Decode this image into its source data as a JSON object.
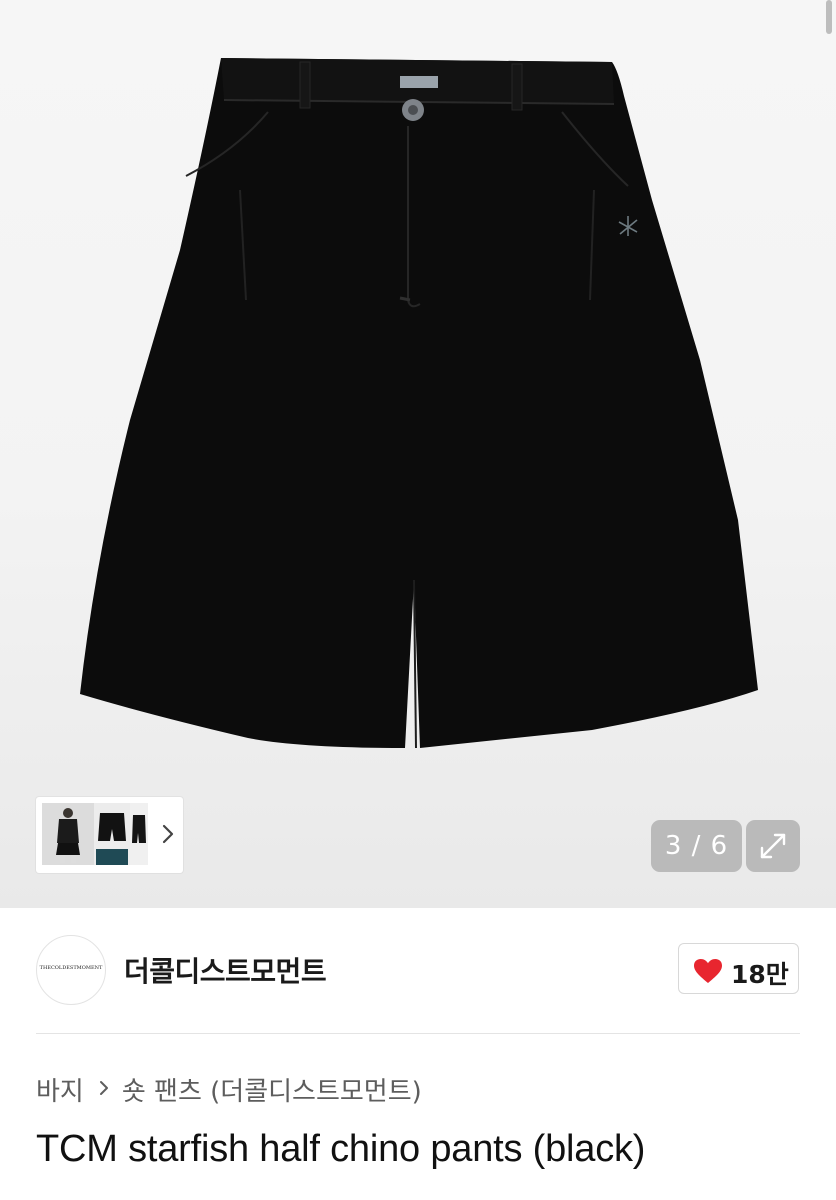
{
  "gallery": {
    "counter": "3 / 6",
    "current_index": 3,
    "total": 6
  },
  "brand": {
    "logo_text": "THECOLDESTMOMENT",
    "name": "더콜디스트모먼트"
  },
  "like": {
    "count": "18만"
  },
  "breadcrumb": {
    "items": [
      "바지",
      "숏 팬츠 (더콜디스트모먼트)"
    ]
  },
  "product": {
    "title": "TCM starfish half chino pants (black)"
  },
  "colors": {
    "heart": "#e8262f",
    "overlay": "#787878"
  },
  "icons": {
    "next": "chevron-right-icon",
    "expand": "expand-icon",
    "like": "heart-icon"
  }
}
